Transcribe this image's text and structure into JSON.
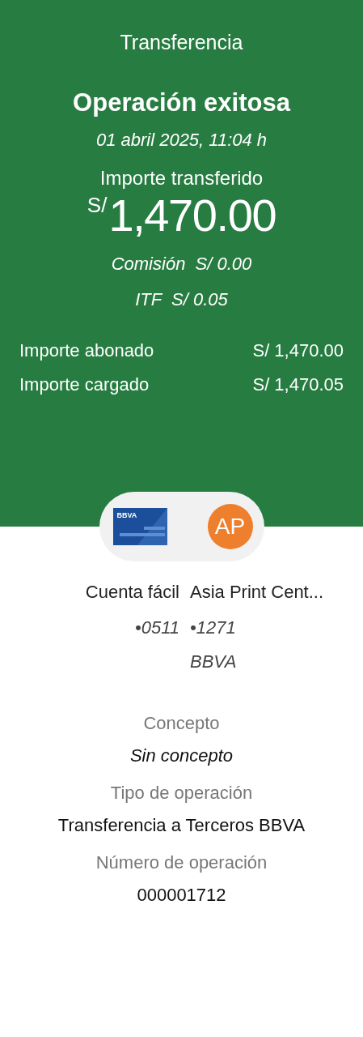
{
  "header": {
    "title": "Transferencia",
    "status": "Operación exitosa",
    "datetime": "01 abril 2025, 11:04 h",
    "amount_label": "Importe transferido",
    "amount_currency": "S/",
    "amount": "1,470.00",
    "fees": [
      {
        "label": "Comisión",
        "value": "S/ 0.00"
      },
      {
        "label": "ITF",
        "value": "S/ 0.05"
      }
    ],
    "summary": [
      {
        "label": "Importe abonado",
        "value": "S/ 1,470.00"
      },
      {
        "label": "Importe cargado",
        "value": "S/ 1,470.05"
      }
    ]
  },
  "parties": {
    "card_logo": "BBVA",
    "avatar_initials": "AP",
    "origin": {
      "name": "Cuenta fácil",
      "account": "•0511"
    },
    "destination": {
      "name": "Asia Print Cent...",
      "account": "•1271",
      "bank": "BBVA"
    }
  },
  "details": [
    {
      "label": "Concepto",
      "value": "Sin concepto",
      "kind": "italic"
    },
    {
      "label": "Tipo de operación",
      "value": "Transferencia a Terceros BBVA",
      "kind": "plain"
    },
    {
      "label": "Número de operación",
      "value": "000001712",
      "kind": "plain"
    }
  ]
}
